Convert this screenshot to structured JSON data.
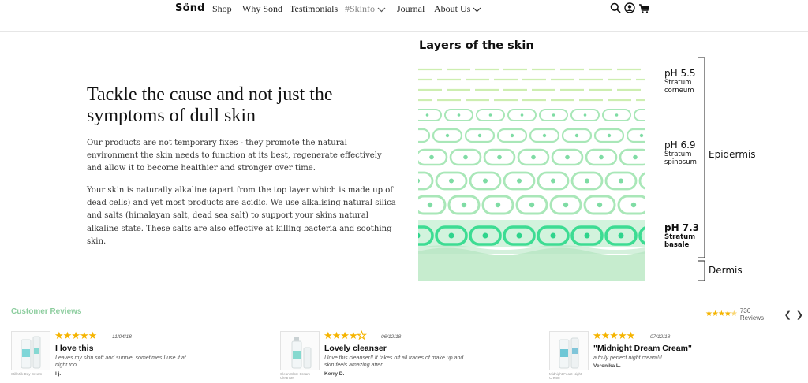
{
  "nav": {
    "brand": "Sönd",
    "items": [
      {
        "label": "Shop"
      },
      {
        "label": "Why Sond"
      },
      {
        "label": "Testimonials"
      },
      {
        "label": "#Skinfo"
      },
      {
        "label": "Journal"
      },
      {
        "label": "About Us"
      }
    ],
    "icons": [
      "search-icon",
      "account-icon",
      "cart-icon"
    ]
  },
  "hero": {
    "headline": "Tackle the cause and not just the symptoms of dull skin",
    "paragraph1": "Our products are not temporary fixes - they promote the natural environment the skin needs to function at its best, regenerate effectively and allow it to become healthier and stronger over time.",
    "paragraph2": "Your skin is naturally alkaline (apart from the top layer which is made up of dead cells) and yet most products are acidic. We use alkalising natural silica and salts (himalayan salt, dead sea salt) to support your skins natural alkaline state. These salts are also effective at killing bacteria and soothing skin."
  },
  "diagram": {
    "title": "Layers of the skin",
    "layers": [
      {
        "ph": "pH 5.5",
        "name": "Stratum corneum",
        "color": "#c8f0a6"
      },
      {
        "ph": "pH 6.9",
        "name": "Stratum spinosum",
        "color": "#9ce6b4"
      },
      {
        "ph": "pH 7.3",
        "name": "Stratum basale",
        "color": "#2ed48c"
      }
    ],
    "epidermis_label": "Epidermis",
    "dermis_label": "Dermis",
    "line_color": "#a9e7b8",
    "basale_bg": "#d2f3dd",
    "dermis_bg": "#c6ecce"
  },
  "reviews": {
    "title": "Customer Reviews",
    "summary_rating": 4.5,
    "summary_count": "736 Reviews",
    "items": [
      {
        "product": "StillMilk Day Cream",
        "rating": 5,
        "date": "11/04/18",
        "title": "I love this",
        "body": "Leaves my skin soft and supple, sometimes I use it at night too",
        "author": "I j."
      },
      {
        "product": "Clean Slate Cream Cleanser",
        "rating": 4,
        "date": "06/12/18",
        "title": "Lovely cleanser",
        "body": "I love this cleanser!! It takes off all traces of make up and skin feels amazing after.",
        "author": "Kerry D."
      },
      {
        "product": "Midnight Feast Night Cream",
        "rating": 5,
        "date": "07/12/18",
        "title": "\"Midnight Dream Cream\"",
        "body": "a truly perfect night cream!!!",
        "author": "Veronika L."
      }
    ],
    "star_color": "#f5b400",
    "accent_color": "#8ccd9e"
  }
}
